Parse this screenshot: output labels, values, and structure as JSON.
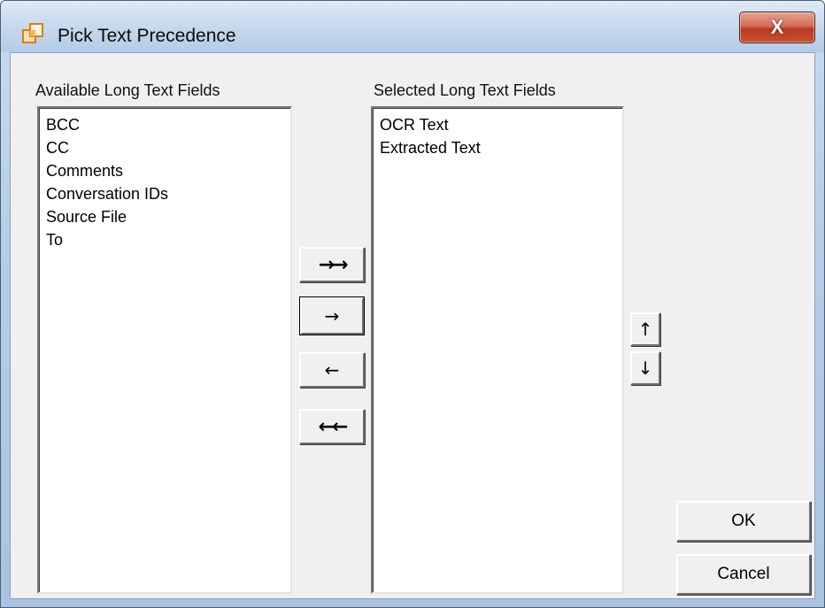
{
  "window": {
    "title": "Pick Text Precedence",
    "close_label": "X",
    "icon": "app-window-icon"
  },
  "available": {
    "label": "Available Long Text Fields",
    "items": [
      "BCC",
      "CC",
      "Comments",
      "Conversation IDs",
      "Source File",
      "To"
    ]
  },
  "selected": {
    "label": "Selected Long Text Fields",
    "items": [
      "OCR Text",
      "Extracted Text"
    ]
  },
  "transfer": {
    "add_all": "→→",
    "add_one": "→",
    "remove_one": "←",
    "remove_all": "←←"
  },
  "order": {
    "up": "↑",
    "down": "↓"
  },
  "actions": {
    "ok": "OK",
    "cancel": "Cancel"
  }
}
